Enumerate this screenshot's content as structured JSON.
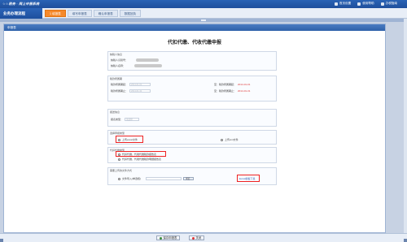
{
  "header": {
    "brand": "☆☆税务 · 网上申报系统",
    "links": [
      {
        "label": "首页设置",
        "icon": "home-icon"
      },
      {
        "label": "使用帮助",
        "icon": "help-icon"
      },
      {
        "label": "办税指南",
        "icon": "guide-icon"
      }
    ]
  },
  "flow": {
    "title": "业务办理流程",
    "steps": [
      {
        "label": "1 填报表"
      },
      {
        "label": "填写申报表"
      },
      {
        "label": "确认申报表"
      },
      {
        "label": "数据回执"
      }
    ]
  },
  "panel": {
    "head": "申报表"
  },
  "form": {
    "title": "代扣代缴、代收代缴申报",
    "taxpayer": {
      "label": "纳税人信息",
      "id_label": "纳税人识别号：",
      "name_label": "纳税人名称："
    },
    "period": {
      "label": "税款所属期",
      "start_label": "税款所属期起：",
      "start_value": "2014-01-01",
      "end_label": "税款所属期止：",
      "end_value": "2014-01-31",
      "sb_start_label": "至：税款所属期起：",
      "sb_start_value": "2014-01-01",
      "sb_end_label": "至：税款所属期止：",
      "sb_end_value": "2014-01-31"
    },
    "report": {
      "label": "报送信息",
      "type_label": "报表类型：",
      "type_value": "请选择"
    },
    "method": {
      "label": "选择申报类型",
      "opt1": "上传excel文件",
      "opt2": "上传xml文件"
    },
    "category": {
      "label": "代扣代缴类型",
      "opt1": "代扣代缴、代收代缴税款报告表",
      "opt2": "代扣代缴、代收代缴税款明细报告表"
    },
    "upload": {
      "label": "需要上传的文件方式",
      "file_label": "文件导入(单选框)",
      "browse": "浏览...",
      "template_link": "Excel模板下载"
    }
  },
  "footer": {
    "save": "保存申报表",
    "close": "关闭"
  },
  "colors": {
    "accent": "#1e4f9c",
    "active_step": "#f5892b",
    "highlight": "#e22222"
  }
}
